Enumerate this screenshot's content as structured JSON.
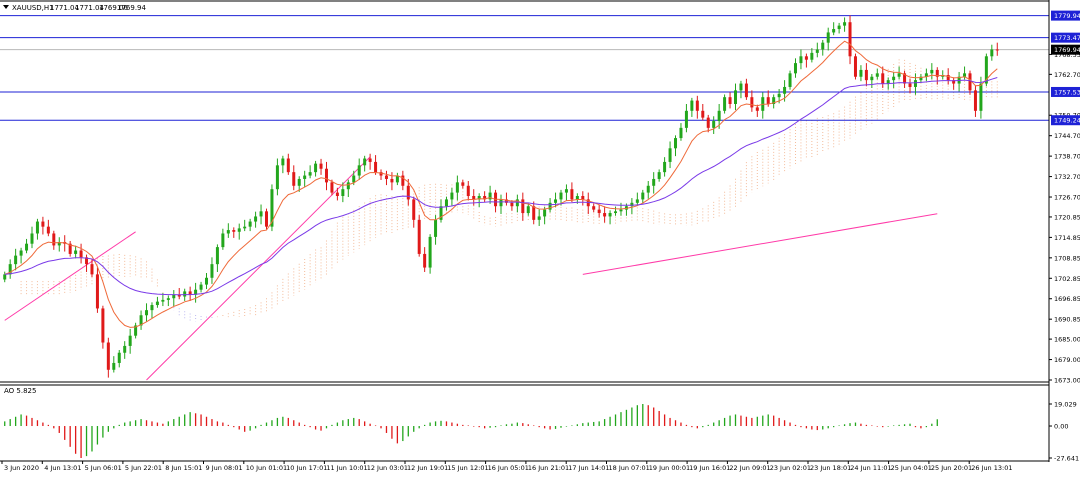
{
  "symbol_info": {
    "symbol": "XAUUSD,H1",
    "open": "1771.04",
    "high": "1771.04",
    "low": "1769.06",
    "close": "1769.94"
  },
  "oscillator": {
    "label": "AO 5.825",
    "axis_labels": [
      "19.029",
      "0.00",
      "-27.641"
    ]
  },
  "price_axis": {
    "labels": [
      "1768.55",
      "1762.70",
      "1750.70",
      "1744.70",
      "1738.70",
      "1732.70",
      "1726.70",
      "1720.85",
      "1714.85",
      "1708.85",
      "1702.85",
      "1696.85",
      "1690.85",
      "1685.00",
      "1679.00",
      "1673.00"
    ],
    "markers": [
      {
        "text": "1779.94",
        "color": "#1e22d6",
        "value": 1779.94
      },
      {
        "text": "1773.47",
        "color": "#1e22d6",
        "value": 1773.47
      },
      {
        "text": "1769.94",
        "color": "#000000",
        "value": 1769.94
      },
      {
        "text": "1757.53",
        "color": "#1e22d6",
        "value": 1757.53
      },
      {
        "text": "1749.24",
        "color": "#1e22d6",
        "value": 1749.24
      }
    ]
  },
  "time_axis": {
    "labels": [
      "3 Jun 2020",
      "4 Jun 13:01",
      "5 Jun 06:01",
      "5 Jun 22:01",
      "8 Jun 15:01",
      "9 Jun 08:01",
      "10 Jun 01:01",
      "10 Jun 17:01",
      "11 Jun 10:01",
      "12 Jun 03:01",
      "12 Jun 19:01",
      "15 Jun 12:01",
      "16 Jun 05:01",
      "16 Jun 21:01",
      "17 Jun 14:01",
      "18 Jun 07:01",
      "19 Jun 00:01",
      "19 Jun 16:01",
      "22 Jun 09:01",
      "23 Jun 02:01",
      "23 Jun 18:01",
      "24 Jun 11:01",
      "25 Jun 04:01",
      "25 Jun 20:01",
      "26 Jun 13:01"
    ]
  },
  "colors": {
    "bull": "#22a61c",
    "bear": "#e01919",
    "hline": "#1e22d6",
    "trend": "#ff3aa8",
    "ma_fast": "#ef6a3a",
    "ma_slow": "#7a3ae8",
    "cloud_a": "#f0a77c",
    "cloud_b": "#a9a4ec"
  },
  "chart_data": {
    "type": "candlestick",
    "symbol": "XAUUSD",
    "timeframe": "H1",
    "y_range": [
      1673.0,
      1781.0
    ],
    "horizontal_levels": [
      1779.94,
      1773.47,
      1757.53,
      1749.24
    ],
    "current_price": 1769.94,
    "closes": [
      1704.0,
      1707.0,
      1709.5,
      1711.0,
      1713.0,
      1716.0,
      1719.5,
      1718.0,
      1716.0,
      1712.5,
      1713.5,
      1713.0,
      1710.0,
      1711.0,
      1709.0,
      1707.0,
      1704.0,
      1694.0,
      1684.0,
      1676.0,
      1678.0,
      1681.0,
      1683.0,
      1686.0,
      1689.0,
      1692.0,
      1693.5,
      1695.0,
      1696.0,
      1696.5,
      1697.0,
      1698.0,
      1697.5,
      1699.0,
      1698.0,
      1699.5,
      1701.0,
      1703.0,
      1707.0,
      1712.0,
      1716.0,
      1717.0,
      1716.5,
      1717.5,
      1718.0,
      1719.5,
      1721.0,
      1722.5,
      1718.0,
      1729.0,
      1736.0,
      1738.0,
      1734.0,
      1730.0,
      1732.0,
      1733.0,
      1734.0,
      1736.5,
      1735.0,
      1731.0,
      1728.0,
      1727.0,
      1729.0,
      1731.0,
      1733.0,
      1736.0,
      1738.0,
      1737.0,
      1734.0,
      1733.0,
      1732.0,
      1731.0,
      1733.0,
      1730.0,
      1726.0,
      1720.0,
      1710.0,
      1706.0,
      1715.0,
      1720.0,
      1724.0,
      1726.0,
      1728.0,
      1731.0,
      1730.0,
      1727.0,
      1726.0,
      1727.0,
      1726.0,
      1728.0,
      1724.0,
      1726.0,
      1725.0,
      1724.0,
      1726.0,
      1722.0,
      1724.0,
      1720.0,
      1721.0,
      1723.0,
      1725.0,
      1726.0,
      1728.0,
      1729.0,
      1726.0,
      1727.0,
      1726.0,
      1724.0,
      1723.0,
      1722.0,
      1721.0,
      1722.0,
      1722.5,
      1723.0,
      1724.0,
      1725.0,
      1726.0,
      1728.0,
      1730.0,
      1732.0,
      1734.0,
      1737.0,
      1741.0,
      1744.0,
      1747.0,
      1752.0,
      1755.0,
      1752.0,
      1750.0,
      1747.0,
      1749.0,
      1752.0,
      1756.0,
      1754.0,
      1758.0,
      1760.0,
      1756.0,
      1753.0,
      1752.0,
      1756.0,
      1754.0,
      1756.0,
      1757.0,
      1759.0,
      1763.0,
      1766.0,
      1768.0,
      1767.0,
      1769.0,
      1770.0,
      1772.0,
      1775.0,
      1776.0,
      1777.0,
      1778.0,
      1768.0,
      1762.0,
      1764.0,
      1761.0,
      1762.0,
      1763.0,
      1760.0,
      1761.0,
      1762.0,
      1763.0,
      1760.0,
      1759.0,
      1761.0,
      1762.0,
      1763.0,
      1764.0,
      1762.0,
      1762.5,
      1761.0,
      1760.0,
      1762.0,
      1763.0,
      1758.0,
      1752.0,
      1760.0,
      1768.0,
      1770.0,
      1769.94
    ],
    "ao": [
      4.0,
      6.0,
      8.0,
      10.0,
      9.0,
      7.0,
      5.0,
      3.0,
      1.0,
      -2.0,
      -6.0,
      -12.0,
      -18.0,
      -24.0,
      -27.641,
      -26.0,
      -22.0,
      -16.0,
      -10.0,
      -5.0,
      -2.0,
      1.0,
      3.0,
      4.0,
      5.0,
      6.0,
      5.0,
      4.0,
      3.0,
      2.0,
      4.0,
      6.0,
      8.0,
      10.0,
      12.0,
      11.0,
      10.0,
      8.0,
      6.0,
      4.0,
      3.0,
      1.0,
      -1.0,
      -3.0,
      -5.0,
      -4.0,
      -2.0,
      1.0,
      3.0,
      5.0,
      7.0,
      8.0,
      7.0,
      5.0,
      3.0,
      1.0,
      -1.0,
      -3.0,
      -4.0,
      -2.0,
      1.0,
      3.0,
      5.0,
      6.0,
      7.0,
      6.0,
      4.0,
      2.0,
      0.5,
      -2.0,
      -6.0,
      -11.0,
      -15.0,
      -13.0,
      -9.0,
      -5.0,
      -2.0,
      1.0,
      3.0,
      4.0,
      4.5,
      4.0,
      3.0,
      2.0,
      1.0,
      0.5,
      -0.5,
      -1.0,
      -2.0,
      -1.5,
      -1.0,
      0.5,
      1.5,
      2.0,
      3.0,
      2.5,
      1.5,
      0.5,
      -1.0,
      -2.0,
      -3.0,
      -2.5,
      -1.5,
      -0.5,
      0.5,
      1.5,
      2.5,
      3.0,
      3.5,
      4.0,
      6.0,
      8.0,
      10.0,
      12.0,
      14.0,
      16.0,
      18.0,
      19.029,
      18.0,
      16.0,
      13.0,
      10.0,
      7.0,
      5.0,
      3.0,
      1.0,
      -1.0,
      -2.0,
      -1.0,
      1.0,
      3.0,
      5.0,
      7.0,
      9.0,
      10.0,
      9.0,
      8.0,
      7.0,
      8.0,
      9.0,
      10.0,
      9.0,
      7.0,
      5.0,
      3.0,
      1.0,
      -1.0,
      -2.0,
      -3.0,
      -3.5,
      -3.0,
      -2.0,
      -1.0,
      0.5,
      1.5,
      2.5,
      3.0,
      2.0,
      1.0,
      0.5,
      -0.5,
      -1.0,
      -0.5,
      0.5,
      1.0,
      1.5,
      2.0,
      -1.0,
      -2.0,
      -1.0,
      2.0,
      5.825
    ]
  }
}
